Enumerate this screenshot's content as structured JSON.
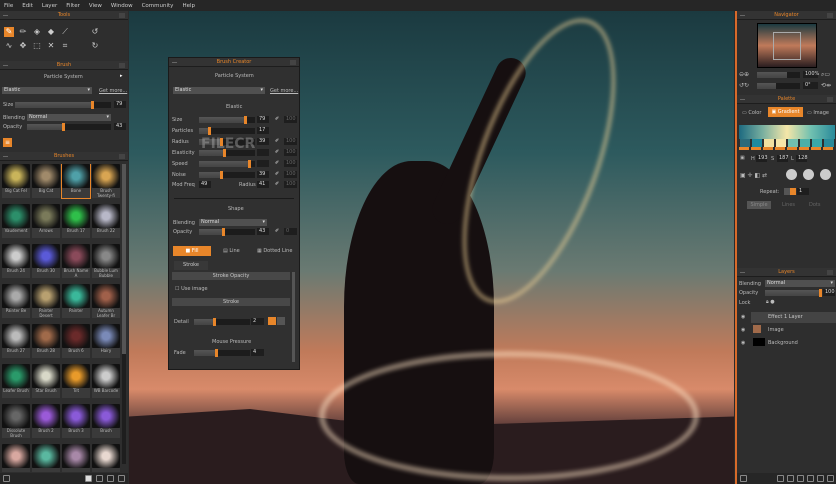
{
  "menu": [
    "File",
    "Edit",
    "Layer",
    "Filter",
    "View",
    "Window",
    "Community",
    "Help"
  ],
  "tools_panel": {
    "title": "Tools"
  },
  "brush_panel": {
    "title": "Brush",
    "system": "Particle System",
    "preset": "Elastic",
    "get_more": "Get more...",
    "size_label": "Size",
    "size": "79",
    "size_pct": 0.8,
    "blending_label": "Blending",
    "blending": "Normal",
    "opacity_label": "Opacity",
    "opacity": "43",
    "opacity_pct": 0.43
  },
  "brushes_panel": {
    "title": "Brushes",
    "items": [
      {
        "name": "Big Cat Fel",
        "c": "#c9b45a"
      },
      {
        "name": "Big Cat",
        "c": "#a08a6a"
      },
      {
        "name": "Bone",
        "c": "#4fa0a8"
      },
      {
        "name": "Brush Twenty-fi",
        "c": "#d9a552"
      },
      {
        "name": "Vaudement",
        "c": "#2c8f6a"
      },
      {
        "name": "Arrows",
        "c": "#7a7a5a"
      },
      {
        "name": "Brush 17",
        "c": "#2fbf4a"
      },
      {
        "name": "Brush 22",
        "c": "#b8b8c8"
      },
      {
        "name": "Brush 24",
        "c": "#cccccc"
      },
      {
        "name": "Brush 30",
        "c": "#5a5ad8"
      },
      {
        "name": "Brush Name A",
        "c": "#8a4a5a"
      },
      {
        "name": "Bubble Lum Bubble",
        "c": "#888888"
      },
      {
        "name": "Painter Be",
        "c": "#aaaaaa"
      },
      {
        "name": "Painter Desert",
        "c": "#b8a070"
      },
      {
        "name": "Painter",
        "c": "#3ab89a"
      },
      {
        "name": "Autumn Leafer Br",
        "c": "#a0604a"
      },
      {
        "name": "Brush 27",
        "c": "#bbbbbb"
      },
      {
        "name": "Brush 28",
        "c": "#a06a4a"
      },
      {
        "name": "Brush 6",
        "c": "#6a2a2a"
      },
      {
        "name": "Hairy",
        "c": "#7a8ab8"
      },
      {
        "name": "Leafer Brush",
        "c": "#2a9a6a"
      },
      {
        "name": "Star Brush",
        "c": "#d8d8c8"
      },
      {
        "name": "Tilt",
        "c": "#e89a2a"
      },
      {
        "name": "WB Barcode",
        "c": "#cccccc"
      },
      {
        "name": "Dissolute Brush",
        "c": "#666666"
      },
      {
        "name": "Brush 2",
        "c": "#9a5ad8"
      },
      {
        "name": "Brush 3",
        "c": "#8a5ad8"
      },
      {
        "name": "Brush",
        "c": "#8a5ad8"
      },
      {
        "name": "",
        "c": "#d8a8a0"
      },
      {
        "name": "",
        "c": "#5ab8a0"
      },
      {
        "name": "",
        "c": "#a888a8"
      },
      {
        "name": "",
        "c": "#e8d8d0"
      }
    ]
  },
  "brush_creator": {
    "title": "Brush Creator",
    "system": "Particle System",
    "preset": "Elastic",
    "get_more": "Get more...",
    "section": "Elastic",
    "rows": [
      {
        "label": "Size",
        "value": "79",
        "pct": 0.82,
        "extra": "100"
      },
      {
        "label": "Particles",
        "value": "17",
        "pct": 0.17,
        "extra": ""
      },
      {
        "label": "Radius",
        "value": "39",
        "pct": 0.39,
        "extra": "100"
      },
      {
        "label": "Elasticity",
        "value": "",
        "pct": 0.45,
        "extra": "100"
      },
      {
        "label": "Speed",
        "value": "",
        "pct": 0.9,
        "extra": "100"
      },
      {
        "label": "Noise",
        "value": "39",
        "pct": 0.39,
        "extra": "100"
      }
    ],
    "mod_freq_label": "Mod Freq",
    "mod_freq": "49",
    "radius_label": "Radius",
    "radius": "41",
    "radius_extra": "100",
    "shape_section": "Shape",
    "blending_label": "Blending",
    "blending": "Normal",
    "opacity_label": "Opacity",
    "opacity": "43",
    "opacity_pct": 0.43,
    "opacity_extra": "0",
    "tabs": [
      "Fill",
      "Line",
      "Dotted Line"
    ],
    "stroke_tab": "Stroke",
    "stroke_opacity": "Stroke Opacity",
    "use_image": "Use image",
    "stroke": "Stroke",
    "detail_label": "Detail",
    "detail": "2",
    "detail_pct": 0.35,
    "mouse_pressure": "Mouse Pressure",
    "fade_label": "Fade",
    "fade": "4",
    "fade_pct": 0.4
  },
  "navigator": {
    "title": "Navigator",
    "zoom": "100%",
    "rotation": "0°"
  },
  "palette": {
    "title": "Palette",
    "tabs": [
      "Color",
      "Gradient",
      "Image"
    ],
    "h_label": "H",
    "h": "193",
    "s_label": "S",
    "s": "187",
    "l_label": "L",
    "l": "128",
    "repeat_label": "Repeat:",
    "repeat": "1",
    "modes": [
      "Simple",
      "Lines",
      "Dots"
    ],
    "colors": [
      "#2a6a7a",
      "#1d8aa0",
      "#f0e0a0",
      "#f5e6a8",
      "#70c0b0",
      "#4ab0a8",
      "#3aa8a8",
      "#2a8a9a"
    ]
  },
  "layers": {
    "title": "Layers",
    "blending_label": "Blending",
    "blending": "Normal",
    "opacity_label": "Opacity",
    "opacity": "100",
    "lock_label": "Lock",
    "items": [
      "Effect 1 Layer",
      "Image",
      "Background"
    ]
  },
  "watermark": "FILECR"
}
